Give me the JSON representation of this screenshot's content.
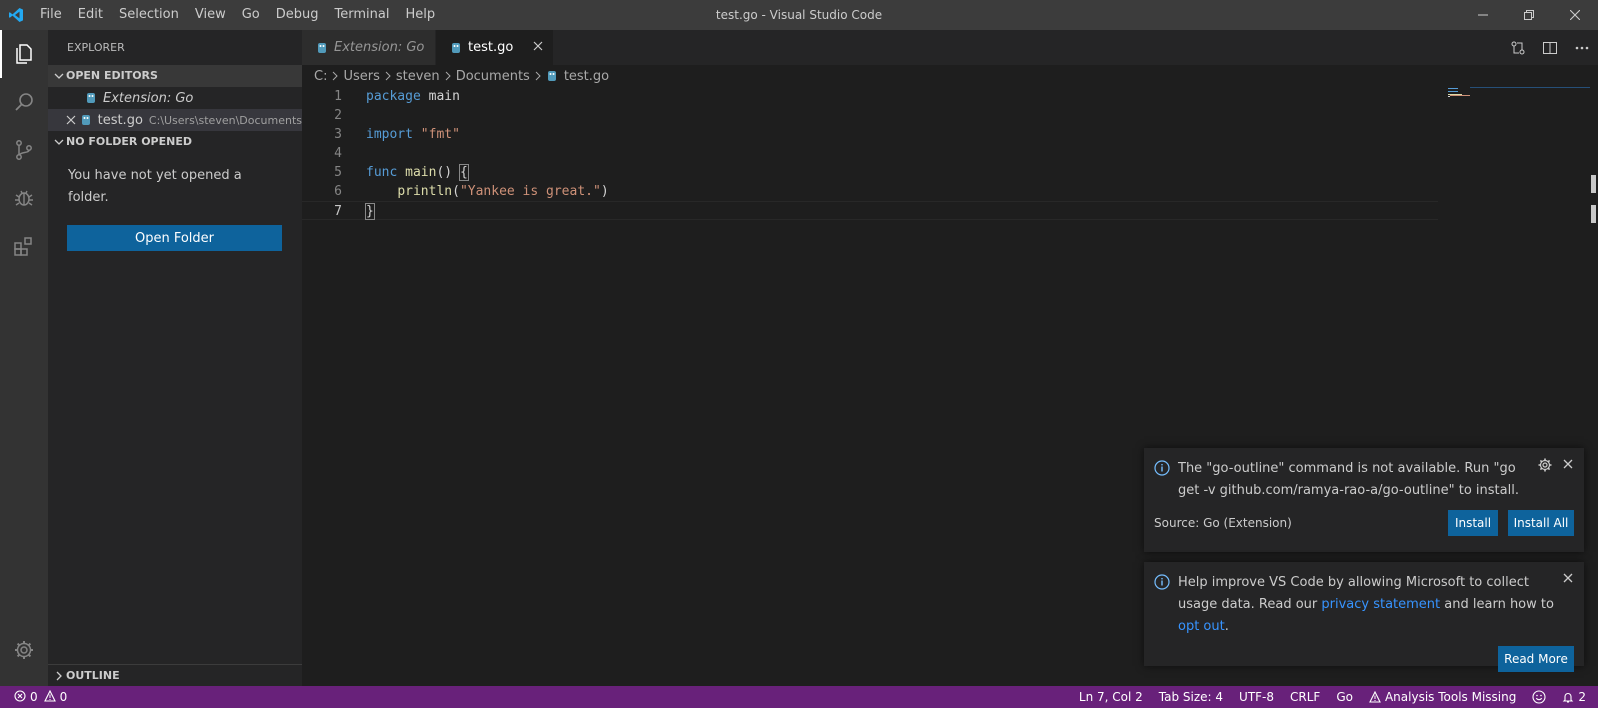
{
  "window": {
    "title": "test.go - Visual Studio Code"
  },
  "menu": [
    "File",
    "Edit",
    "Selection",
    "View",
    "Go",
    "Debug",
    "Terminal",
    "Help"
  ],
  "sidebar": {
    "title": "EXPLORER",
    "open_editors_label": "OPEN EDITORS",
    "open_editors": [
      {
        "name": "Extension: Go",
        "path": ""
      },
      {
        "name": "test.go",
        "path": "C:\\Users\\steven\\Documents"
      }
    ],
    "no_folder_label": "NO FOLDER OPENED",
    "empty_message": "You have not yet opened a folder.",
    "open_folder_button": "Open Folder",
    "outline_label": "OUTLINE"
  },
  "tabs": [
    {
      "label": "Extension: Go",
      "active": false
    },
    {
      "label": "test.go",
      "active": true
    }
  ],
  "breadcrumbs": [
    "C:",
    "Users",
    "steven",
    "Documents",
    "test.go"
  ],
  "code": {
    "line_numbers": [
      "1",
      "2",
      "3",
      "4",
      "5",
      "6",
      "7"
    ],
    "l1_kw": "package",
    "l1_rest": " main",
    "l3_kw": "import",
    "l3_str": "\"fmt\"",
    "l5_kw": "func",
    "l5_fn": "main",
    "l5_rest": "() ",
    "l5_brace": "{",
    "l6_fn": "println",
    "l6_open": "(",
    "l6_str": "\"Yankee is great.\"",
    "l6_close": ")",
    "l7_brace": "}"
  },
  "notifications": {
    "go_outline": {
      "message": "The \"go-outline\" command is not available. Run \"go get -v github.com/ramya-rao-a/go-outline\" to install.",
      "source": "Source: Go (Extension)",
      "install_label": "Install",
      "install_all_label": "Install All"
    },
    "telemetry": {
      "message_start": "Help improve VS Code by allowing Microsoft to collect usage data. Read our ",
      "privacy_link": "privacy statement",
      "message_mid": " and learn how to ",
      "opt_out_link": "opt out",
      "message_end": ".",
      "read_more_label": "Read More"
    }
  },
  "statusbar": {
    "errors": "0",
    "warnings": "0",
    "position": "Ln 7, Col 2",
    "tab_size": "Tab Size: 4",
    "encoding": "UTF-8",
    "eol": "CRLF",
    "language": "Go",
    "analysis": "Analysis Tools Missing",
    "notifications_count": "2"
  },
  "colors": {
    "statusbar": "#68217a",
    "accent_button": "#0e639c",
    "link": "#3794ff",
    "vscode_logo": "#23a9f2"
  }
}
